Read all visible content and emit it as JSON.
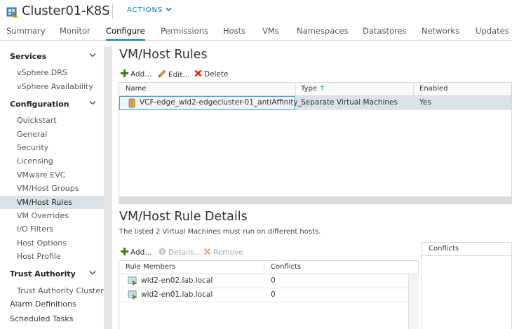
{
  "header": {
    "title": "Cluster01-K8S",
    "actions_label": "ACTIONS",
    "icon": "cluster-warning-icon"
  },
  "tabs": [
    {
      "label": "Summary"
    },
    {
      "label": "Monitor"
    },
    {
      "label": "Configure",
      "active": true
    },
    {
      "label": "Permissions"
    },
    {
      "label": "Hosts"
    },
    {
      "label": "VMs"
    },
    {
      "label": "Namespaces"
    },
    {
      "label": "Datastores"
    },
    {
      "label": "Networks"
    },
    {
      "label": "Updates"
    }
  ],
  "sidebar": {
    "services": {
      "label": "Services",
      "items": [
        "vSphere DRS",
        "vSphere Availability"
      ]
    },
    "configuration": {
      "label": "Configuration",
      "items": [
        "Quickstart",
        "General",
        "Security",
        "Licensing",
        "VMware EVC",
        "VM/Host Groups",
        "VM/Host Rules",
        "VM Overrides",
        "I/O Filters",
        "Host Options",
        "Host Profile"
      ],
      "selected": "VM/Host Rules"
    },
    "trust_authority": {
      "label": "Trust Authority",
      "items": [
        "Trust Authority Cluster"
      ]
    },
    "others": [
      "Alarm Definitions",
      "Scheduled Tasks"
    ]
  },
  "rules": {
    "title": "VM/Host Rules",
    "toolbar": {
      "add": "Add...",
      "edit": "Edit...",
      "delete": "Delete"
    },
    "columns": {
      "name": "Name",
      "type": "Type",
      "enabled": "Enabled"
    },
    "rows": [
      {
        "name": "VCF-edge_wld2-edgecluster-01_antiAffinity_...",
        "type": "Separate Virtual Machines",
        "enabled": "Yes"
      }
    ]
  },
  "details": {
    "title": "VM/Host Rule Details",
    "description": "The listed 2 Virtual Machines must run on different hosts.",
    "toolbar": {
      "add": "Add...",
      "details": "Details...",
      "remove": "Remove"
    },
    "columns": {
      "members": "Rule Members",
      "conflicts": "Conflicts"
    },
    "rows": [
      {
        "member": "wld2-en02.lab.local",
        "conflicts": "0"
      },
      {
        "member": "wld2-en01.lab.local",
        "conflicts": "0"
      }
    ],
    "conflicts_panel_title": "Conflicts"
  },
  "colors": {
    "accent": "#0079b8",
    "add_green": "#2f8400",
    "delete_red": "#e12200",
    "selected_bg": "#d8e3e9"
  }
}
